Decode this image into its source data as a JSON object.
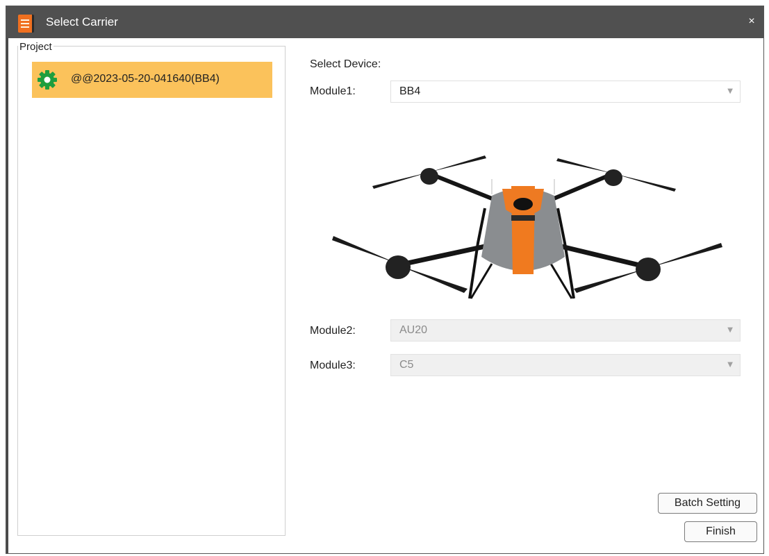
{
  "window": {
    "title": "Select Carrier",
    "close_glyph": "×"
  },
  "project": {
    "legend": "Project",
    "items": [
      {
        "label": "@@2023-05-20-041640(BB4)",
        "icon": "gear-icon",
        "selected": true
      }
    ]
  },
  "device": {
    "heading": "Select Device:",
    "module1": {
      "label": "Module1:",
      "value": "BB4",
      "enabled": true
    },
    "module2": {
      "label": "Module2:",
      "value": "AU20",
      "enabled": false
    },
    "module3": {
      "label": "Module3:",
      "value": "C5",
      "enabled": false
    },
    "dropdown_arrow": "▼"
  },
  "buttons": {
    "batch_setting": "Batch Setting",
    "finish": "Finish"
  },
  "colors": {
    "titlebar": "#505050",
    "selection": "#fbc25b",
    "accent": "#f07020",
    "gear": "#1e9e3e"
  }
}
